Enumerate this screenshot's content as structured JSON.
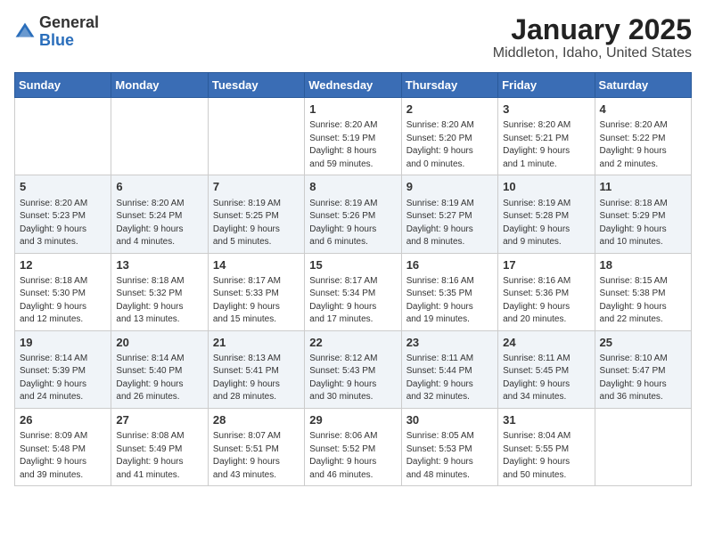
{
  "header": {
    "logo": {
      "general": "General",
      "blue": "Blue"
    },
    "title": "January 2025",
    "location": "Middleton, Idaho, United States"
  },
  "weekdays": [
    "Sunday",
    "Monday",
    "Tuesday",
    "Wednesday",
    "Thursday",
    "Friday",
    "Saturday"
  ],
  "weeks": [
    [
      {
        "day": "",
        "info": ""
      },
      {
        "day": "",
        "info": ""
      },
      {
        "day": "",
        "info": ""
      },
      {
        "day": "1",
        "info": "Sunrise: 8:20 AM\nSunset: 5:19 PM\nDaylight: 8 hours\nand 59 minutes."
      },
      {
        "day": "2",
        "info": "Sunrise: 8:20 AM\nSunset: 5:20 PM\nDaylight: 9 hours\nand 0 minutes."
      },
      {
        "day": "3",
        "info": "Sunrise: 8:20 AM\nSunset: 5:21 PM\nDaylight: 9 hours\nand 1 minute."
      },
      {
        "day": "4",
        "info": "Sunrise: 8:20 AM\nSunset: 5:22 PM\nDaylight: 9 hours\nand 2 minutes."
      }
    ],
    [
      {
        "day": "5",
        "info": "Sunrise: 8:20 AM\nSunset: 5:23 PM\nDaylight: 9 hours\nand 3 minutes."
      },
      {
        "day": "6",
        "info": "Sunrise: 8:20 AM\nSunset: 5:24 PM\nDaylight: 9 hours\nand 4 minutes."
      },
      {
        "day": "7",
        "info": "Sunrise: 8:19 AM\nSunset: 5:25 PM\nDaylight: 9 hours\nand 5 minutes."
      },
      {
        "day": "8",
        "info": "Sunrise: 8:19 AM\nSunset: 5:26 PM\nDaylight: 9 hours\nand 6 minutes."
      },
      {
        "day": "9",
        "info": "Sunrise: 8:19 AM\nSunset: 5:27 PM\nDaylight: 9 hours\nand 8 minutes."
      },
      {
        "day": "10",
        "info": "Sunrise: 8:19 AM\nSunset: 5:28 PM\nDaylight: 9 hours\nand 9 minutes."
      },
      {
        "day": "11",
        "info": "Sunrise: 8:18 AM\nSunset: 5:29 PM\nDaylight: 9 hours\nand 10 minutes."
      }
    ],
    [
      {
        "day": "12",
        "info": "Sunrise: 8:18 AM\nSunset: 5:30 PM\nDaylight: 9 hours\nand 12 minutes."
      },
      {
        "day": "13",
        "info": "Sunrise: 8:18 AM\nSunset: 5:32 PM\nDaylight: 9 hours\nand 13 minutes."
      },
      {
        "day": "14",
        "info": "Sunrise: 8:17 AM\nSunset: 5:33 PM\nDaylight: 9 hours\nand 15 minutes."
      },
      {
        "day": "15",
        "info": "Sunrise: 8:17 AM\nSunset: 5:34 PM\nDaylight: 9 hours\nand 17 minutes."
      },
      {
        "day": "16",
        "info": "Sunrise: 8:16 AM\nSunset: 5:35 PM\nDaylight: 9 hours\nand 19 minutes."
      },
      {
        "day": "17",
        "info": "Sunrise: 8:16 AM\nSunset: 5:36 PM\nDaylight: 9 hours\nand 20 minutes."
      },
      {
        "day": "18",
        "info": "Sunrise: 8:15 AM\nSunset: 5:38 PM\nDaylight: 9 hours\nand 22 minutes."
      }
    ],
    [
      {
        "day": "19",
        "info": "Sunrise: 8:14 AM\nSunset: 5:39 PM\nDaylight: 9 hours\nand 24 minutes."
      },
      {
        "day": "20",
        "info": "Sunrise: 8:14 AM\nSunset: 5:40 PM\nDaylight: 9 hours\nand 26 minutes."
      },
      {
        "day": "21",
        "info": "Sunrise: 8:13 AM\nSunset: 5:41 PM\nDaylight: 9 hours\nand 28 minutes."
      },
      {
        "day": "22",
        "info": "Sunrise: 8:12 AM\nSunset: 5:43 PM\nDaylight: 9 hours\nand 30 minutes."
      },
      {
        "day": "23",
        "info": "Sunrise: 8:11 AM\nSunset: 5:44 PM\nDaylight: 9 hours\nand 32 minutes."
      },
      {
        "day": "24",
        "info": "Sunrise: 8:11 AM\nSunset: 5:45 PM\nDaylight: 9 hours\nand 34 minutes."
      },
      {
        "day": "25",
        "info": "Sunrise: 8:10 AM\nSunset: 5:47 PM\nDaylight: 9 hours\nand 36 minutes."
      }
    ],
    [
      {
        "day": "26",
        "info": "Sunrise: 8:09 AM\nSunset: 5:48 PM\nDaylight: 9 hours\nand 39 minutes."
      },
      {
        "day": "27",
        "info": "Sunrise: 8:08 AM\nSunset: 5:49 PM\nDaylight: 9 hours\nand 41 minutes."
      },
      {
        "day": "28",
        "info": "Sunrise: 8:07 AM\nSunset: 5:51 PM\nDaylight: 9 hours\nand 43 minutes."
      },
      {
        "day": "29",
        "info": "Sunrise: 8:06 AM\nSunset: 5:52 PM\nDaylight: 9 hours\nand 46 minutes."
      },
      {
        "day": "30",
        "info": "Sunrise: 8:05 AM\nSunset: 5:53 PM\nDaylight: 9 hours\nand 48 minutes."
      },
      {
        "day": "31",
        "info": "Sunrise: 8:04 AM\nSunset: 5:55 PM\nDaylight: 9 hours\nand 50 minutes."
      },
      {
        "day": "",
        "info": ""
      }
    ]
  ]
}
